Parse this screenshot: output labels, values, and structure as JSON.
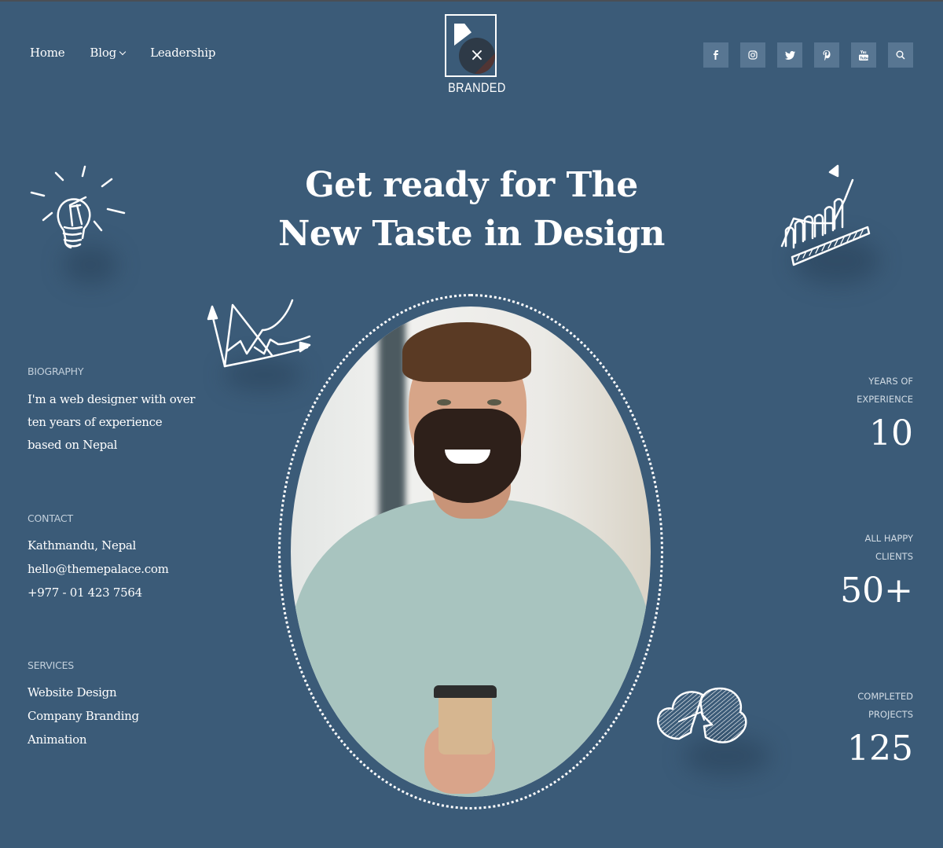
{
  "nav": {
    "items": [
      {
        "label": "Home"
      },
      {
        "label": "Blog",
        "has_dropdown": true
      },
      {
        "label": "Leadership"
      }
    ]
  },
  "logo": {
    "text": "BRANDED",
    "overlay_close": "×"
  },
  "social": [
    {
      "icon": "facebook-icon",
      "glyph": "f"
    },
    {
      "icon": "instagram-icon",
      "glyph": "◎"
    },
    {
      "icon": "twitter-icon",
      "glyph": "🐦"
    },
    {
      "icon": "pinterest-icon",
      "glyph": "℗"
    },
    {
      "icon": "youtube-icon",
      "glyph": "▶"
    },
    {
      "icon": "search-icon",
      "glyph": "⌕"
    }
  ],
  "hero": {
    "title_line1": "Get ready for The",
    "title_line2": "New Taste in Design"
  },
  "biography": {
    "label": "BIOGRAPHY",
    "line1": "I'm a web designer with over",
    "line2": "ten years of experience",
    "line3": "based on Nepal"
  },
  "contact": {
    "label": "CONTACT",
    "address": "Kathmandu, Nepal",
    "email": "hello@themepalace.com",
    "phone": "+977 - 01 423 7564"
  },
  "services": {
    "label": "SERVICES",
    "items": [
      "Website Design",
      "Company Branding",
      "Animation"
    ]
  },
  "stats": [
    {
      "label_line1": "YEARS OF",
      "label_line2": "EXPERIENCE",
      "value": "10"
    },
    {
      "label_line1": "ALL HAPPY",
      "label_line2": "CLIENTS",
      "value": "50+"
    },
    {
      "label_line1": "COMPLETED",
      "label_line2": "PROJECTS",
      "value": "125"
    }
  ],
  "colors": {
    "background": "#3b5b78",
    "social_button": "#587692",
    "text": "#ffffff",
    "label_text": "#c3d0dc"
  }
}
